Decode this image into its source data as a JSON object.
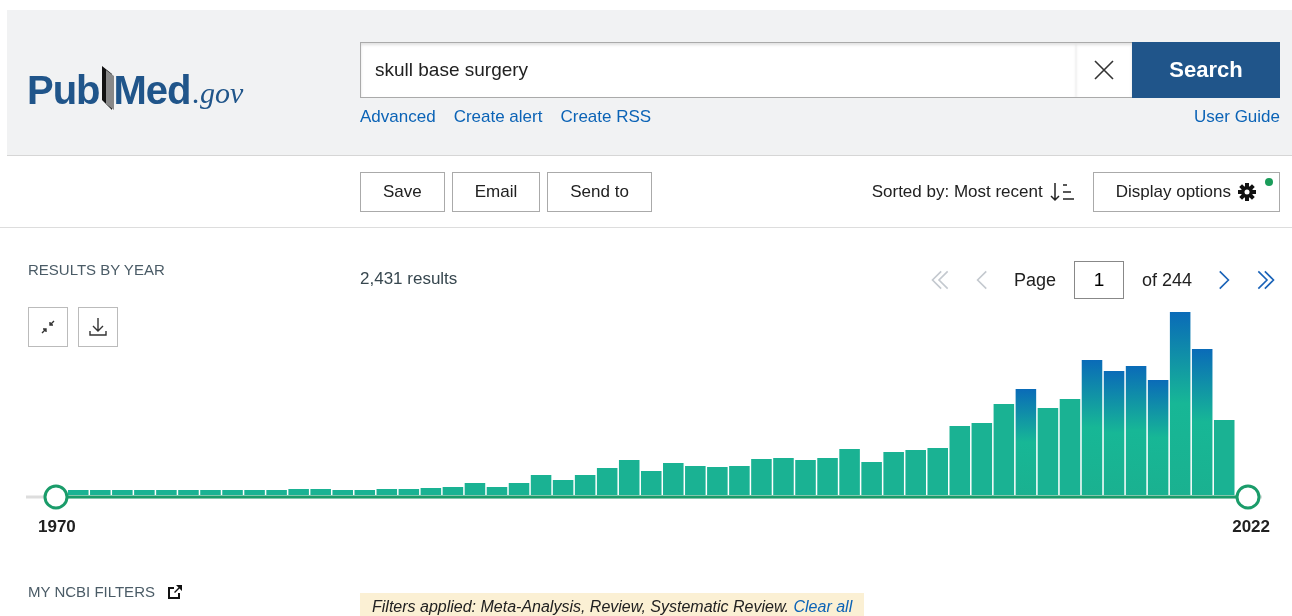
{
  "header": {
    "logo": {
      "part_1": "Pub",
      "part_2": "Med",
      "domain": ".gov"
    },
    "search": {
      "value": "skull base surgery",
      "button": "Search"
    },
    "links": [
      "Advanced",
      "Create alert",
      "Create RSS"
    ],
    "user_guide": "User Guide"
  },
  "actions": {
    "buttons": [
      "Save",
      "Email",
      "Send to"
    ],
    "sort": "Sorted by: Most recent",
    "display_options": "Display options"
  },
  "results_by_year": {
    "title": "RESULTS BY YEAR",
    "start_year": "1970",
    "end_year": "2022"
  },
  "results": {
    "count": "2,431 results"
  },
  "pagination": {
    "label": "Page",
    "page": "1",
    "total": "of 244",
    "nav": [
      {
        "kind": "first",
        "disabled": true
      },
      {
        "kind": "prev",
        "disabled": true
      },
      {
        "kind": "next",
        "disabled": false
      },
      {
        "kind": "last",
        "disabled": false
      }
    ]
  },
  "my_ncbi_filters": "MY NCBI FILTERS",
  "filters_applied": {
    "text": "*Filters applied: Meta-Analysis, Review, Systematic Review.*",
    "clear": "Clear all"
  }
}
